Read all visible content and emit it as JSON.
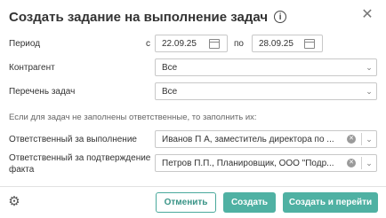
{
  "dialog": {
    "title": "Создать задание на выполнение задач",
    "info_icon": "info-icon",
    "close_icon": "close-icon"
  },
  "period": {
    "label": "Период",
    "from_label": "с",
    "from_value": "22.09.25",
    "to_label": "по",
    "to_value": "28.09.25"
  },
  "counterparty": {
    "label": "Контрагент",
    "value": "Все"
  },
  "task_list": {
    "label": "Перечень задач",
    "value": "Все"
  },
  "hint": "Если для задач не заполнены ответственные, то заполнить их:",
  "executor": {
    "label": "Ответственный за выполнение",
    "value": "Иванов П А, заместитель директора по ..."
  },
  "approver": {
    "label_line1": "Ответственный за подтверждение",
    "label_line2": "факта",
    "value": "Петров П.П., Планировщик, ООО \"Подр..."
  },
  "footer": {
    "settings_icon": "gear-icon",
    "cancel_label": "Отменить",
    "create_label": "Создать",
    "create_go_label": "Создать и перейти"
  },
  "colors": {
    "accent": "#4fb1a3",
    "accent_text": "#3a9487"
  }
}
